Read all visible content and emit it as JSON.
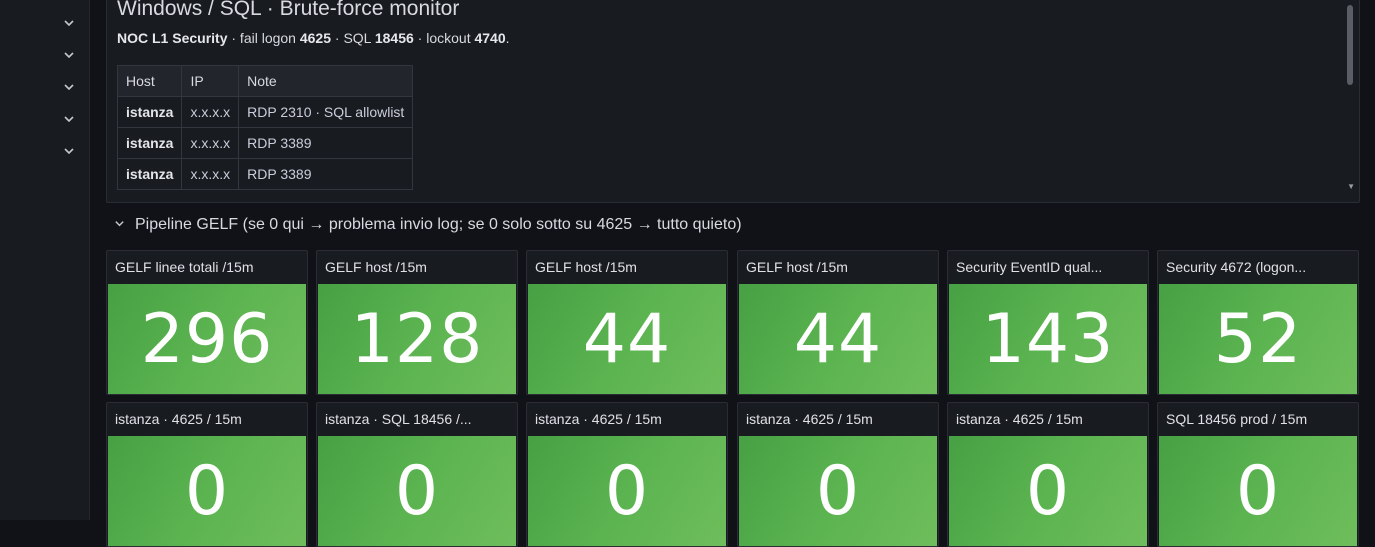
{
  "sidebar": {
    "chevrons": [
      "chevron-down-icon",
      "chevron-down-icon",
      "chevron-down-icon",
      "chevron-down-icon",
      "chevron-down-icon"
    ]
  },
  "text_panel": {
    "title": "Windows / SQL · Brute-force monitor",
    "subtitle_parts": [
      "NOC L1 Security",
      " · fail logon ",
      "4625",
      " · SQL ",
      "18456",
      " · lockout ",
      "4740",
      "."
    ],
    "table": {
      "headers": [
        "Host",
        "IP",
        "Note"
      ],
      "rows": [
        [
          "istanza",
          "x.x.x.x",
          "RDP 2310 · SQL allowlist"
        ],
        [
          "istanza",
          "x.x.x.x",
          "RDP 3389"
        ],
        [
          "istanza",
          "x.x.x.x",
          "RDP 3389"
        ]
      ]
    }
  },
  "row": {
    "title": "Pipeline GELF (se 0 qui → problema invio log; se 0 solo sotto su 4625 → tutto quieto)"
  },
  "stats_row1": [
    {
      "title": "GELF linee totali /15m",
      "value": "296"
    },
    {
      "title": "GELF host /15m",
      "value": "128"
    },
    {
      "title": "GELF host /15m",
      "value": "44"
    },
    {
      "title": "GELF host /15m",
      "value": "44"
    },
    {
      "title": "Security EventID qual...",
      "value": "143"
    },
    {
      "title": "Security 4672 (logon...",
      "value": "52"
    }
  ],
  "stats_row2": [
    {
      "title": "istanza · 4625 / 15m",
      "value": "0"
    },
    {
      "title": "istanza · SQL 18456 /...",
      "value": "0"
    },
    {
      "title": "istanza · 4625 / 15m",
      "value": "0"
    },
    {
      "title": "istanza · 4625 / 15m",
      "value": "0"
    },
    {
      "title": "istanza · 4625 / 15m",
      "value": "0"
    },
    {
      "title": "SQL 18456 prod / 15m",
      "value": "0"
    }
  ],
  "colors": {
    "background": "#111217",
    "panel": "#181b1f",
    "stat_green": "#56ac4c"
  }
}
